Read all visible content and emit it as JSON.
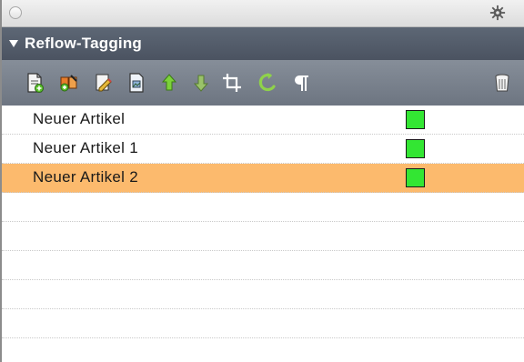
{
  "titlebar": {
    "close_icon": "circle-button",
    "menu_icon": "gear-icon"
  },
  "section": {
    "title": "Reflow-Tagging",
    "expanded": true
  },
  "toolbar": {
    "tools": [
      {
        "name": "new-article-icon",
        "color": "#ffffff"
      },
      {
        "name": "add-to-article-icon",
        "color": "#e07b2c"
      },
      {
        "name": "edit-article-icon",
        "color": "#d9b13a"
      },
      {
        "name": "article-properties-icon",
        "color": "#8fb3d9"
      },
      {
        "name": "move-up-icon",
        "color": "#7cd23a"
      },
      {
        "name": "move-down-icon",
        "color": "#9ac26a"
      },
      {
        "name": "crop-icon",
        "color": "#ffffff"
      },
      {
        "name": "refresh-icon",
        "color": "#8fd24a"
      },
      {
        "name": "paragraph-icon",
        "color": "#ffffff"
      },
      {
        "name": "trash-icon",
        "color": "#ffffff"
      }
    ]
  },
  "articles": [
    {
      "label": "Neuer Artikel",
      "selected": false,
      "status_color": "#33e633"
    },
    {
      "label": "Neuer Artikel 1",
      "selected": false,
      "status_color": "#33e633"
    },
    {
      "label": "Neuer Artikel 2",
      "selected": true,
      "status_color": "#33e633"
    }
  ],
  "colors": {
    "header_bg": "#535c69",
    "toolbar_bg": "#7a828d",
    "selection": "#fcba6d",
    "status_ok": "#33e633"
  }
}
